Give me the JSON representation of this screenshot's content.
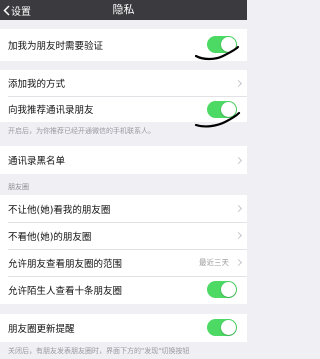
{
  "nav": {
    "back_label": "设置",
    "title": "隐私"
  },
  "group1": {
    "verify_label": "加我为朋友时需要验证",
    "verify_on": true
  },
  "group2": {
    "add_methods_label": "添加我的方式",
    "recommend_label": "向我推荐通讯录朋友",
    "recommend_on": true
  },
  "note_recommend": "开启后，为你推荐已经开通微信的手机联系人。",
  "group3": {
    "blacklist_label": "通讯录黑名单"
  },
  "moments_header": "朋友圈",
  "group4": {
    "block_them_label": "不让他(她)看我的朋友圈",
    "hide_theirs_label": "不看他(她)的朋友圈",
    "range_label": "允许朋友查看朋友圈的范围",
    "range_value": "最近三天",
    "stranger_label": "允许陌生人查看十条朋友圈",
    "stranger_on": true
  },
  "group5": {
    "update_reminder_label": "朋友圈更新提醒",
    "update_reminder_on": true
  },
  "note_update": "关闭后，有朋友发表朋友圈时，界面下方的\"发现\"切换按钮"
}
